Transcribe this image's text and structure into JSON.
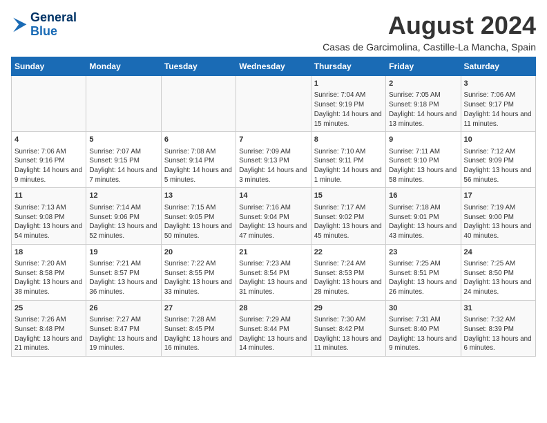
{
  "header": {
    "logo_line1": "General",
    "logo_line2": "Blue",
    "title": "August 2024",
    "subtitle": "Casas de Garcimolina, Castille-La Mancha, Spain"
  },
  "weekdays": [
    "Sunday",
    "Monday",
    "Tuesday",
    "Wednesday",
    "Thursday",
    "Friday",
    "Saturday"
  ],
  "weeks": [
    [
      {
        "day": "",
        "info": ""
      },
      {
        "day": "",
        "info": ""
      },
      {
        "day": "",
        "info": ""
      },
      {
        "day": "",
        "info": ""
      },
      {
        "day": "1",
        "info": "Sunrise: 7:04 AM\nSunset: 9:19 PM\nDaylight: 14 hours and 15 minutes."
      },
      {
        "day": "2",
        "info": "Sunrise: 7:05 AM\nSunset: 9:18 PM\nDaylight: 14 hours and 13 minutes."
      },
      {
        "day": "3",
        "info": "Sunrise: 7:06 AM\nSunset: 9:17 PM\nDaylight: 14 hours and 11 minutes."
      }
    ],
    [
      {
        "day": "4",
        "info": "Sunrise: 7:06 AM\nSunset: 9:16 PM\nDaylight: 14 hours and 9 minutes."
      },
      {
        "day": "5",
        "info": "Sunrise: 7:07 AM\nSunset: 9:15 PM\nDaylight: 14 hours and 7 minutes."
      },
      {
        "day": "6",
        "info": "Sunrise: 7:08 AM\nSunset: 9:14 PM\nDaylight: 14 hours and 5 minutes."
      },
      {
        "day": "7",
        "info": "Sunrise: 7:09 AM\nSunset: 9:13 PM\nDaylight: 14 hours and 3 minutes."
      },
      {
        "day": "8",
        "info": "Sunrise: 7:10 AM\nSunset: 9:11 PM\nDaylight: 14 hours and 1 minute."
      },
      {
        "day": "9",
        "info": "Sunrise: 7:11 AM\nSunset: 9:10 PM\nDaylight: 13 hours and 58 minutes."
      },
      {
        "day": "10",
        "info": "Sunrise: 7:12 AM\nSunset: 9:09 PM\nDaylight: 13 hours and 56 minutes."
      }
    ],
    [
      {
        "day": "11",
        "info": "Sunrise: 7:13 AM\nSunset: 9:08 PM\nDaylight: 13 hours and 54 minutes."
      },
      {
        "day": "12",
        "info": "Sunrise: 7:14 AM\nSunset: 9:06 PM\nDaylight: 13 hours and 52 minutes."
      },
      {
        "day": "13",
        "info": "Sunrise: 7:15 AM\nSunset: 9:05 PM\nDaylight: 13 hours and 50 minutes."
      },
      {
        "day": "14",
        "info": "Sunrise: 7:16 AM\nSunset: 9:04 PM\nDaylight: 13 hours and 47 minutes."
      },
      {
        "day": "15",
        "info": "Sunrise: 7:17 AM\nSunset: 9:02 PM\nDaylight: 13 hours and 45 minutes."
      },
      {
        "day": "16",
        "info": "Sunrise: 7:18 AM\nSunset: 9:01 PM\nDaylight: 13 hours and 43 minutes."
      },
      {
        "day": "17",
        "info": "Sunrise: 7:19 AM\nSunset: 9:00 PM\nDaylight: 13 hours and 40 minutes."
      }
    ],
    [
      {
        "day": "18",
        "info": "Sunrise: 7:20 AM\nSunset: 8:58 PM\nDaylight: 13 hours and 38 minutes."
      },
      {
        "day": "19",
        "info": "Sunrise: 7:21 AM\nSunset: 8:57 PM\nDaylight: 13 hours and 36 minutes."
      },
      {
        "day": "20",
        "info": "Sunrise: 7:22 AM\nSunset: 8:55 PM\nDaylight: 13 hours and 33 minutes."
      },
      {
        "day": "21",
        "info": "Sunrise: 7:23 AM\nSunset: 8:54 PM\nDaylight: 13 hours and 31 minutes."
      },
      {
        "day": "22",
        "info": "Sunrise: 7:24 AM\nSunset: 8:53 PM\nDaylight: 13 hours and 28 minutes."
      },
      {
        "day": "23",
        "info": "Sunrise: 7:25 AM\nSunset: 8:51 PM\nDaylight: 13 hours and 26 minutes."
      },
      {
        "day": "24",
        "info": "Sunrise: 7:25 AM\nSunset: 8:50 PM\nDaylight: 13 hours and 24 minutes."
      }
    ],
    [
      {
        "day": "25",
        "info": "Sunrise: 7:26 AM\nSunset: 8:48 PM\nDaylight: 13 hours and 21 minutes."
      },
      {
        "day": "26",
        "info": "Sunrise: 7:27 AM\nSunset: 8:47 PM\nDaylight: 13 hours and 19 minutes."
      },
      {
        "day": "27",
        "info": "Sunrise: 7:28 AM\nSunset: 8:45 PM\nDaylight: 13 hours and 16 minutes."
      },
      {
        "day": "28",
        "info": "Sunrise: 7:29 AM\nSunset: 8:44 PM\nDaylight: 13 hours and 14 minutes."
      },
      {
        "day": "29",
        "info": "Sunrise: 7:30 AM\nSunset: 8:42 PM\nDaylight: 13 hours and 11 minutes."
      },
      {
        "day": "30",
        "info": "Sunrise: 7:31 AM\nSunset: 8:40 PM\nDaylight: 13 hours and 9 minutes."
      },
      {
        "day": "31",
        "info": "Sunrise: 7:32 AM\nSunset: 8:39 PM\nDaylight: 13 hours and 6 minutes."
      }
    ]
  ]
}
